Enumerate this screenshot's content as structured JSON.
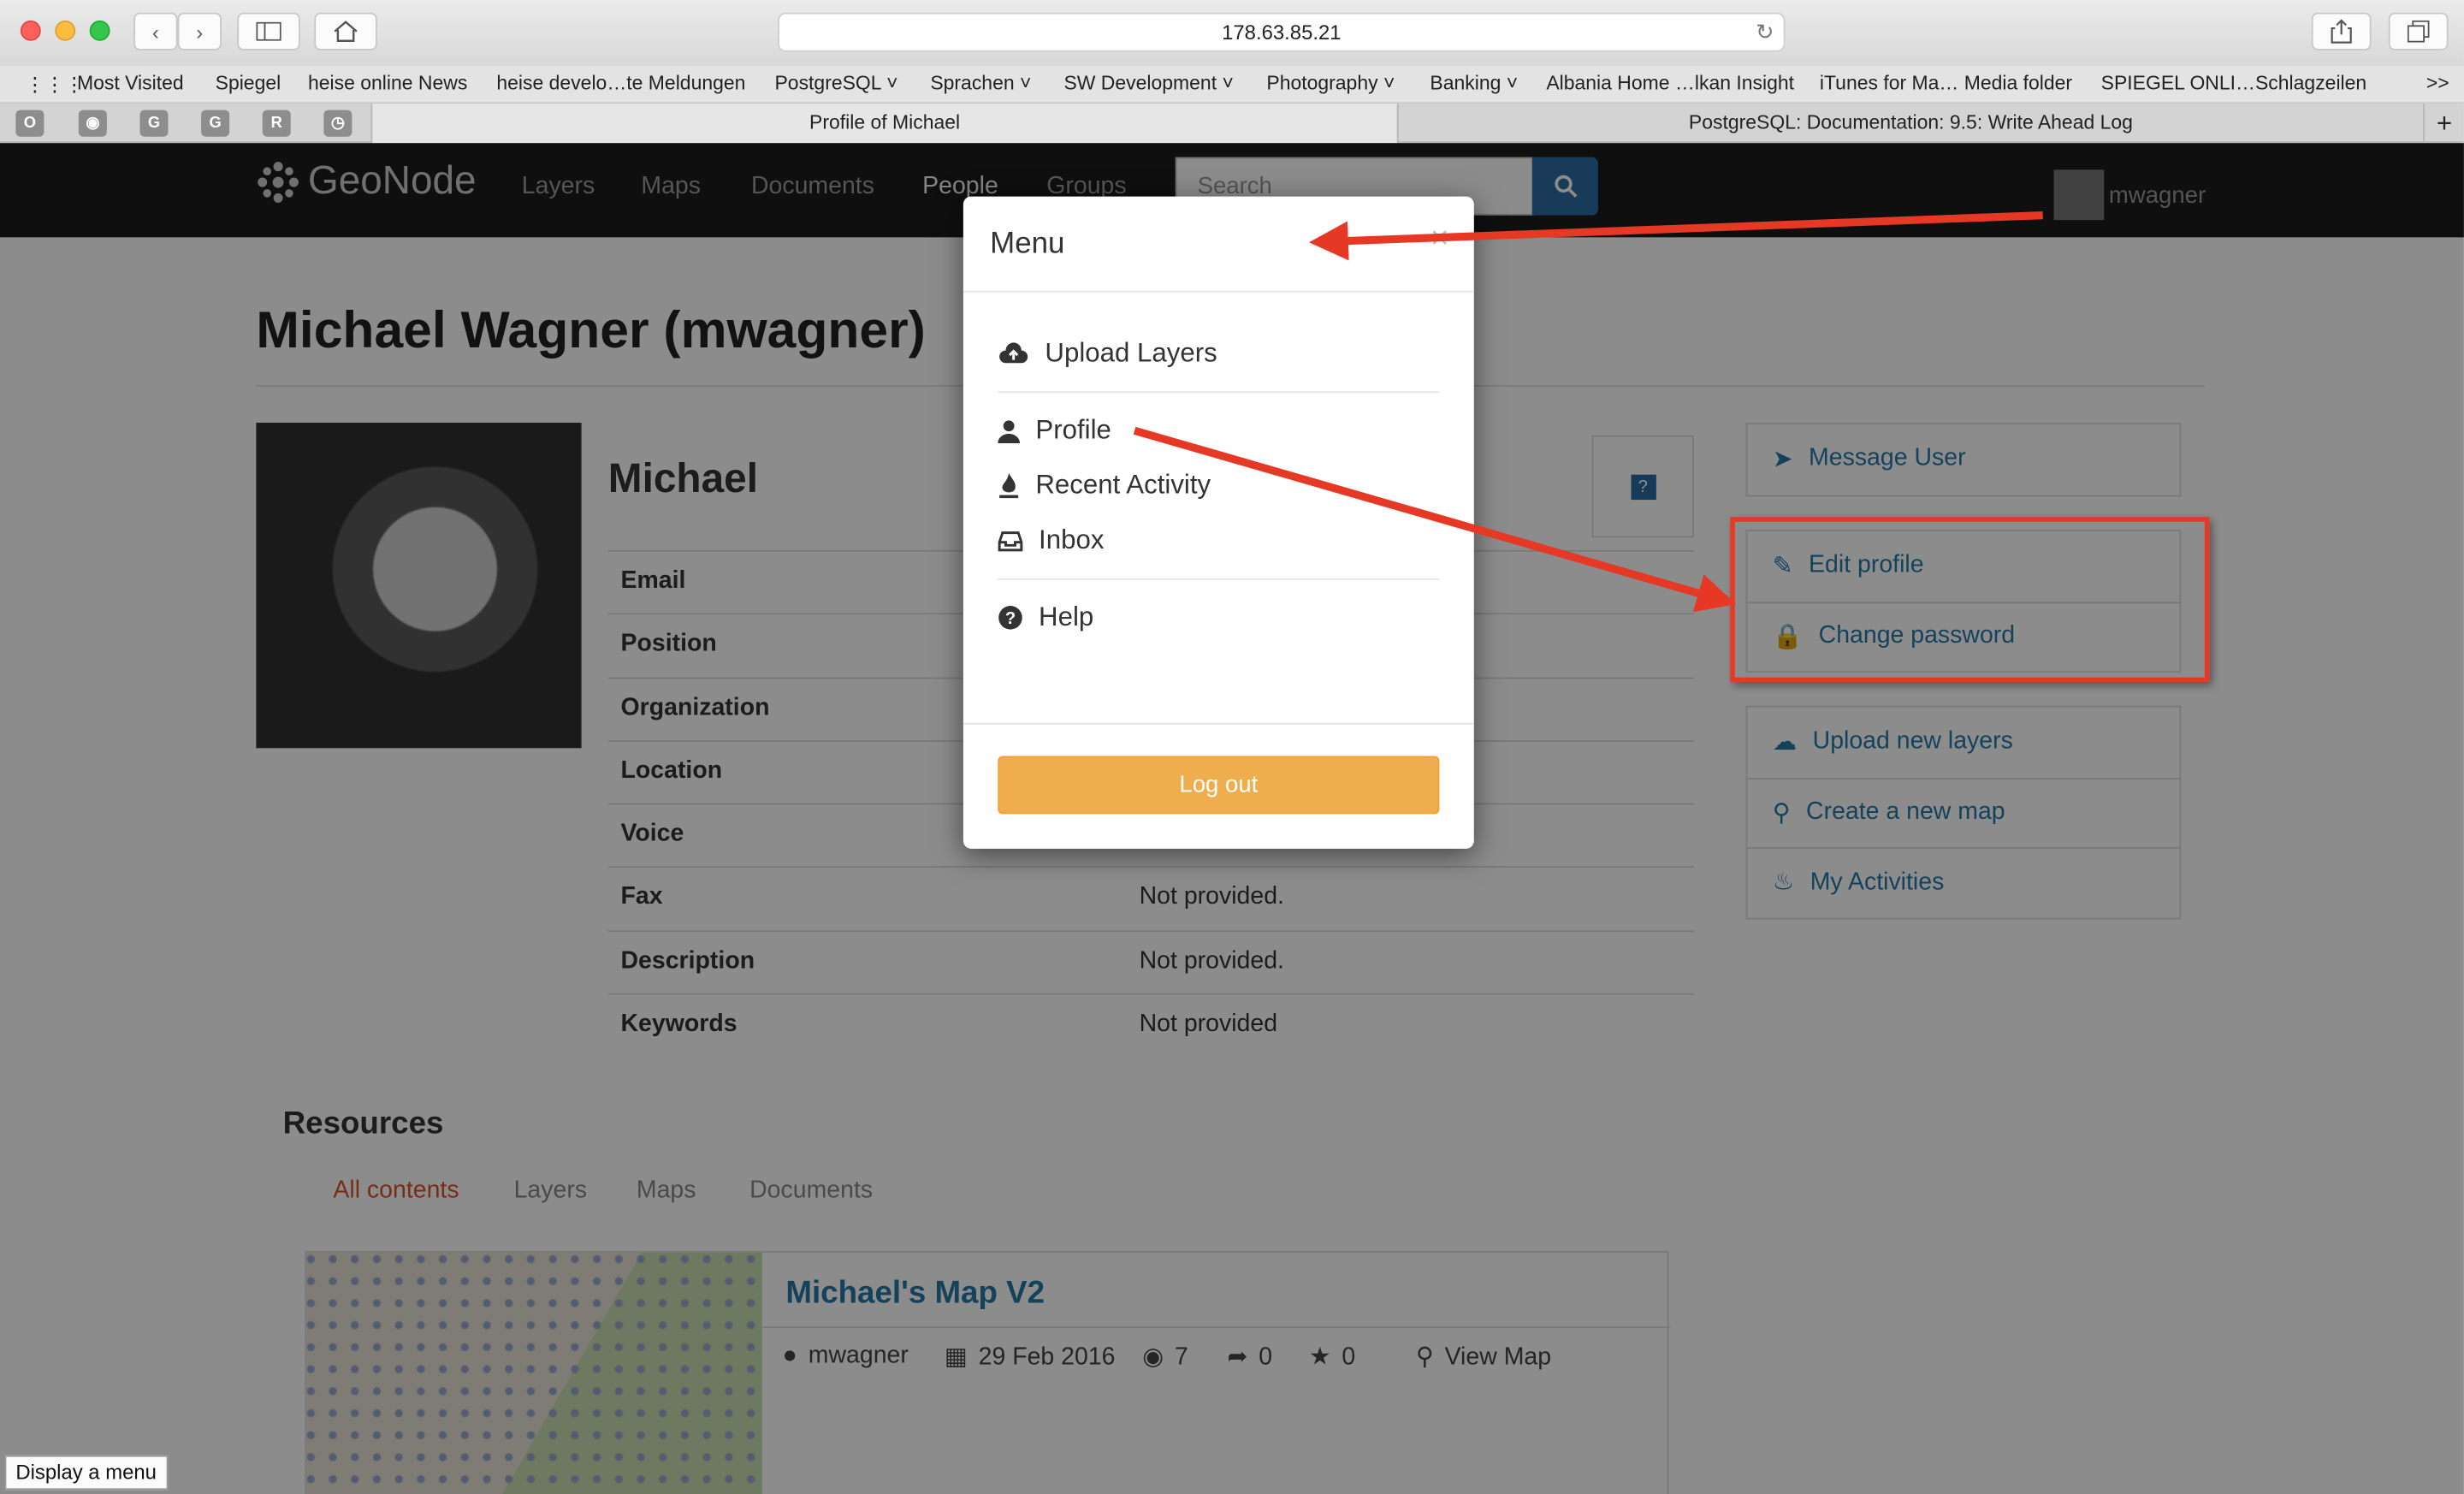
{
  "browser": {
    "url": "178.63.85.21",
    "bookmarks": [
      "Most Visited",
      "Spiegel",
      "heise online News",
      "heise develo…te Meldungen",
      "PostgreSQL",
      "Sprachen",
      "SW Development",
      "Photography",
      "Banking",
      "Albania Home …lkan Insight",
      "iTunes for Ma… Media folder",
      "SPIEGEL ONLI…Schlagzeilen"
    ],
    "overflow": ">>",
    "pinned_tabs": [
      "O",
      "",
      "G",
      "G",
      "R",
      ""
    ],
    "tabs": [
      "Profile of Michael",
      "PostgreSQL: Documentation: 9.5: Write Ahead Log"
    ],
    "new_tab": "+"
  },
  "site": {
    "logo": "GeoNode",
    "nav": [
      "Layers",
      "Maps",
      "Documents",
      "People",
      "Groups"
    ],
    "search_placeholder": "Search",
    "username": "mwagner"
  },
  "profile": {
    "heading": "Michael Wagner (mwagner)",
    "first_name": "Michael",
    "fields": [
      {
        "label": "Email",
        "value": ""
      },
      {
        "label": "Position",
        "value": ""
      },
      {
        "label": "Organization",
        "value": ""
      },
      {
        "label": "Location",
        "value": ""
      },
      {
        "label": "Voice",
        "value": ""
      },
      {
        "label": "Fax",
        "value": "Not provided."
      },
      {
        "label": "Description",
        "value": "Not provided."
      },
      {
        "label": "Keywords",
        "value": "Not provided"
      }
    ]
  },
  "sidebar": {
    "message": "Message User",
    "edit_profile": "Edit profile",
    "change_password": "Change password",
    "upload_layers": "Upload new layers",
    "create_map": "Create a new map",
    "my_activities": "My Activities"
  },
  "resources": {
    "title": "Resources",
    "tabs": [
      "All contents",
      "Layers",
      "Maps",
      "Documents"
    ],
    "card": {
      "title": "Michael's Map V2",
      "owner": "mwagner",
      "date": "29 Feb 2016",
      "views": "7",
      "shares": "0",
      "stars": "0",
      "view_map": "View Map"
    }
  },
  "menu_modal": {
    "title": "Menu",
    "close": "×",
    "items": [
      "Upload Layers",
      "Profile",
      "Recent Activity",
      "Inbox",
      "Help"
    ],
    "logout": "Log out"
  },
  "tooltip": "Display a menu",
  "colors": {
    "link": "#2779a7",
    "annotation_red": "#e53926",
    "logout_orange": "#f0ad4e",
    "nav_bg": "#1d1d1d"
  }
}
